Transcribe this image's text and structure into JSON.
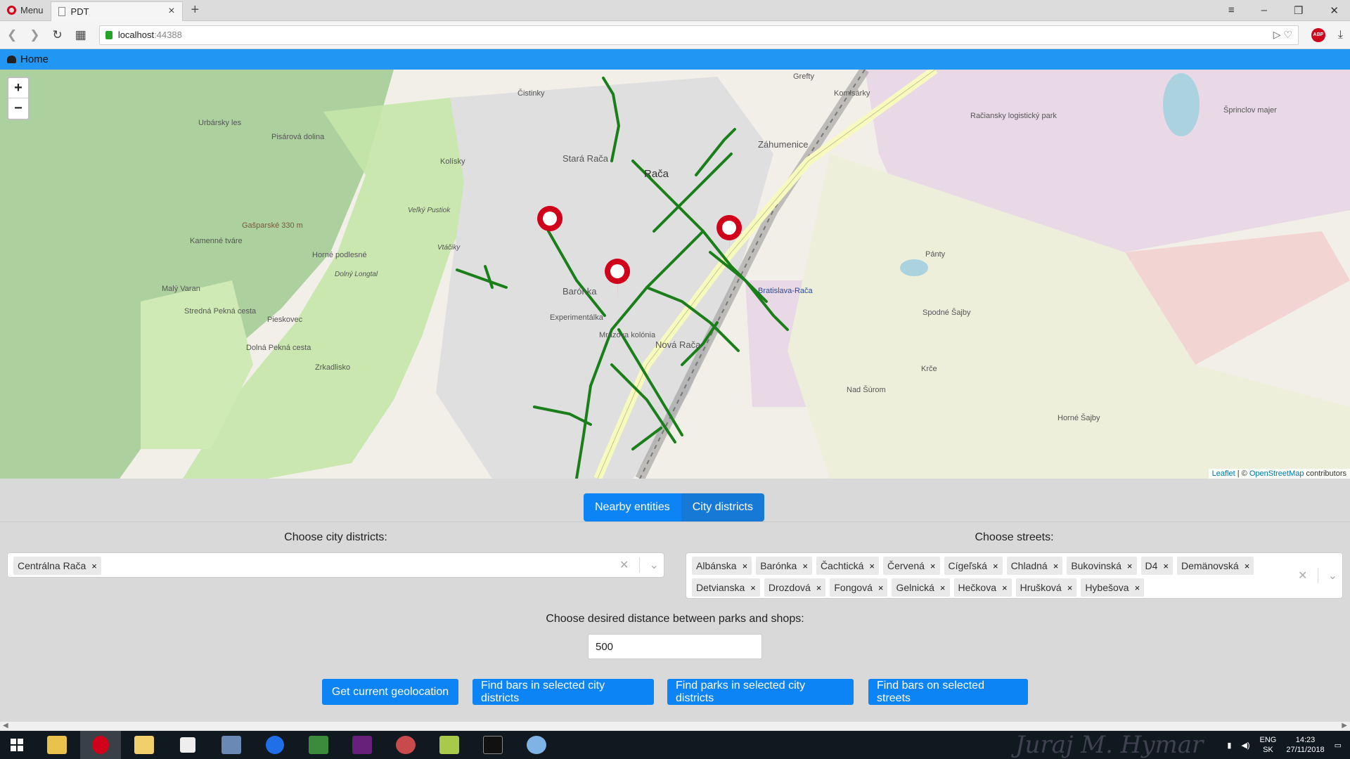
{
  "browser": {
    "menu_label": "Menu",
    "tab_title": "PDT",
    "url_host": "localhost",
    "url_port": ":44388",
    "adblock_label": "ABP"
  },
  "navbar": {
    "home_label": "Home"
  },
  "map": {
    "zoom_in": "+",
    "zoom_out": "−",
    "attribution_leaflet": "Leaflet",
    "attribution_sep": " | © ",
    "attribution_osm": "OpenStreetMap",
    "attribution_rest": " contributors",
    "labels": [
      {
        "text": "Rača",
        "cls": "big"
      },
      {
        "text": "Stará Rača",
        "cls": "big"
      },
      {
        "text": "Nová Rača",
        "cls": "big"
      },
      {
        "text": "Barónka",
        "cls": "big"
      },
      {
        "text": "Záhumenice",
        "cls": "big"
      },
      {
        "text": "Bratislava-Rača",
        "cls": ""
      },
      {
        "text": "Račiansky logistický park",
        "cls": ""
      },
      {
        "text": "Spodné Šajby",
        "cls": ""
      },
      {
        "text": "Horné Šajby",
        "cls": ""
      },
      {
        "text": "Nad Šúrom",
        "cls": ""
      },
      {
        "text": "Krče",
        "cls": ""
      },
      {
        "text": "Pánty",
        "cls": ""
      },
      {
        "text": "Komisárky",
        "cls": ""
      },
      {
        "text": "Čistinky",
        "cls": ""
      },
      {
        "text": "Kolísky",
        "cls": ""
      },
      {
        "text": "Urbársky les",
        "cls": ""
      },
      {
        "text": "Pisárová dolina",
        "cls": ""
      },
      {
        "text": "Kamenné tváre",
        "cls": ""
      },
      {
        "text": "Gašparské 330 m",
        "cls": ""
      },
      {
        "text": "Horné podlesné",
        "cls": ""
      },
      {
        "text": "Dolný Longtal",
        "cls": ""
      },
      {
        "text": "Malý Varan",
        "cls": ""
      },
      {
        "text": "Stredná Pekná cesta",
        "cls": ""
      },
      {
        "text": "Pieskovec",
        "cls": ""
      },
      {
        "text": "Dolná Pekná cesta",
        "cls": ""
      },
      {
        "text": "Zrkadlisko",
        "cls": ""
      },
      {
        "text": "Experimentálka",
        "cls": ""
      },
      {
        "text": "Mrázova kolónia",
        "cls": ""
      },
      {
        "text": "Šprinclov majer",
        "cls": ""
      },
      {
        "text": "Veľký Pustiok",
        "cls": ""
      },
      {
        "text": "Vtáčiky",
        "cls": ""
      },
      {
        "text": "Grefty",
        "cls": ""
      }
    ]
  },
  "tabs": [
    {
      "label": "Nearby entities"
    },
    {
      "label": "City districts"
    }
  ],
  "districts": {
    "label": "Choose city districts:",
    "selected": [
      "Centrálna Rača"
    ]
  },
  "streets": {
    "label": "Choose streets:",
    "selected": [
      "Albánska",
      "Barónka",
      "Čachtická",
      "Červená",
      "Cígeľská",
      "Chladná",
      "Bukovinská",
      "D4",
      "Demänovská",
      "Detvianska",
      "Drozdová",
      "Fongová",
      "Gelnická",
      "Hečkova",
      "Hrušková",
      "Hybešova"
    ]
  },
  "distance": {
    "label": "Choose desired distance between parks and shops:",
    "value": "500"
  },
  "actions": [
    {
      "label": "Get current geolocation"
    },
    {
      "label": "Find bars in selected city districts"
    },
    {
      "label": "Find parks in selected city districts"
    },
    {
      "label": "Find bars on selected streets"
    }
  ],
  "taskbar": {
    "lang": "ENG",
    "lang2": "SK",
    "time": "14:23",
    "date": "27/11/2018",
    "signature": "Juraj M. Hymar"
  },
  "colors": {
    "primary": "#0d84f5",
    "navbar": "#2196f3",
    "street_line": "#1a7f1a",
    "marker": "#d0021b"
  }
}
